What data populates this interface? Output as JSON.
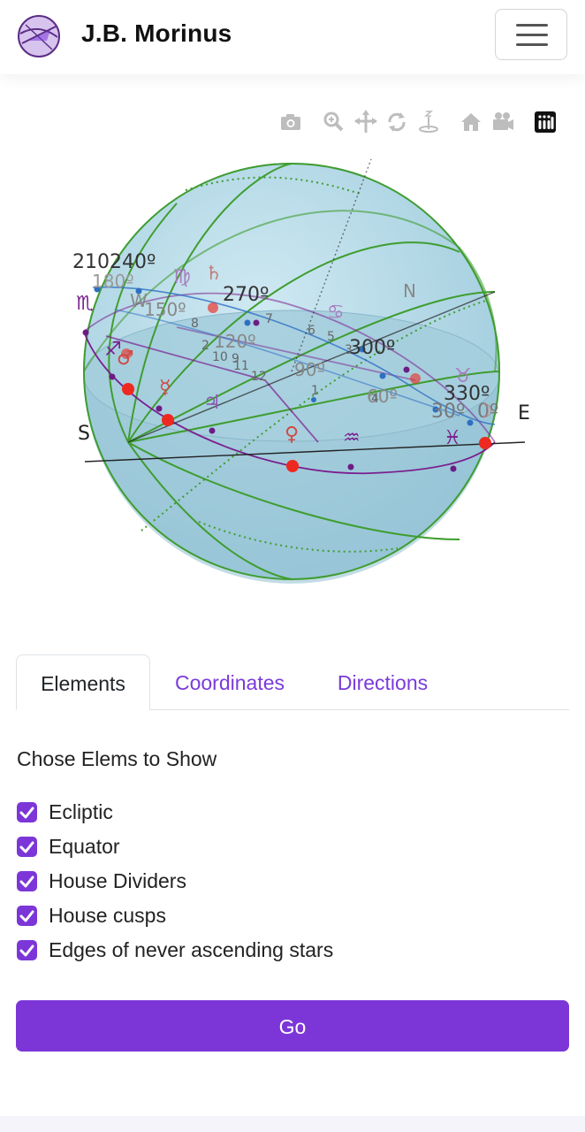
{
  "header": {
    "brand": "J.B. Morinus",
    "logo_icon": "morinus-logo-icon",
    "menu_icon": "hamburger-menu-icon"
  },
  "plot_toolbar": {
    "icons": [
      "camera-icon",
      "zoom-icon",
      "pan-icon",
      "orbit-rotation-icon",
      "turntable-rotation-icon",
      "reset-home-icon",
      "reset-camera-icon",
      "plotly-logo-icon"
    ]
  },
  "sphere": {
    "directions": {
      "south": "S",
      "east": "E",
      "north": "N",
      "west": "W"
    },
    "ecliptic_degrees": [
      "210",
      "240º",
      "270º",
      "300º",
      "330º",
      "30º",
      "0º",
      "150º",
      "120º",
      "90º",
      "60º",
      "180º"
    ],
    "house_numbers": [
      "1",
      "2",
      "3",
      "4",
      "5",
      "6",
      "7",
      "8",
      "9",
      "10",
      "11",
      "12"
    ],
    "zodiac_signs": [
      "♏",
      "♍",
      "♐",
      "♋",
      "♉",
      "♓",
      "♒"
    ],
    "planets": [
      "♄",
      "♃",
      "♂",
      "♀",
      "☿",
      "☽"
    ],
    "colors": {
      "sphere": "#a9d3e3",
      "ecliptic": "#7a1f8e",
      "equator": "#2d6fc2",
      "house_dividers": "#3f9d2f",
      "planet_dot": "#ee2a20"
    }
  },
  "tabs": [
    {
      "label": "Elements",
      "active": true
    },
    {
      "label": "Coordinates",
      "active": false
    },
    {
      "label": "Directions",
      "active": false
    }
  ],
  "panel": {
    "title": "Chose Elems to Show",
    "options": [
      {
        "label": "Ecliptic",
        "checked": true
      },
      {
        "label": "Equator",
        "checked": true
      },
      {
        "label": "House Dividers",
        "checked": true
      },
      {
        "label": "House cusps",
        "checked": true
      },
      {
        "label": "Edges of never ascending stars",
        "checked": true
      }
    ],
    "go_label": "Go",
    "check_icon": "checkmark-icon"
  }
}
